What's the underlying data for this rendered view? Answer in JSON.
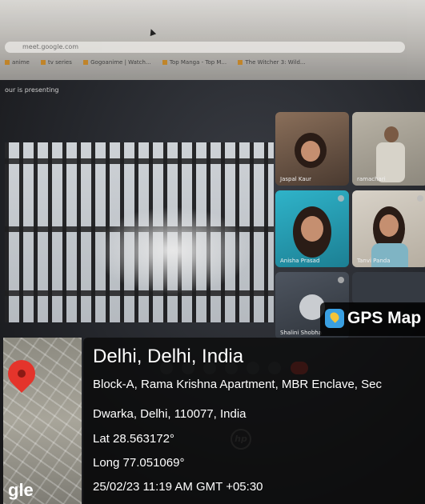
{
  "browser": {
    "url": "meet.google.com",
    "bookmarks": [
      "anime",
      "tv series",
      "Gogoanime | Watch...",
      "Top Manga - Top M...",
      "The Witcher 3: Wild..."
    ],
    "presenting_text": "our is presenting"
  },
  "participants": [
    {
      "name": "Jaspal Kaur"
    },
    {
      "name": "ramachari"
    },
    {
      "name": "Anisha Prasad"
    },
    {
      "name": "Tanvi Panda"
    },
    {
      "name": "Shalini Shobha"
    }
  ],
  "gps": {
    "app_title": "GPS Map",
    "city": "Delhi, Delhi, India",
    "address_line1": "Block-A, Rama Krishna Apartment, MBR Enclave, Sec",
    "address_line2": "Dwarka, Delhi, 110077, India",
    "lat": "Lat 28.563172°",
    "long": "Long 77.051069°",
    "datetime": "25/02/23 11:19 AM GMT +05:30",
    "map_label": "gle"
  },
  "laptop_logo": "hp",
  "colors": {
    "pin": "#e4342b",
    "end_call": "#d33a2f",
    "gps_icon": "#3aa0e2"
  }
}
